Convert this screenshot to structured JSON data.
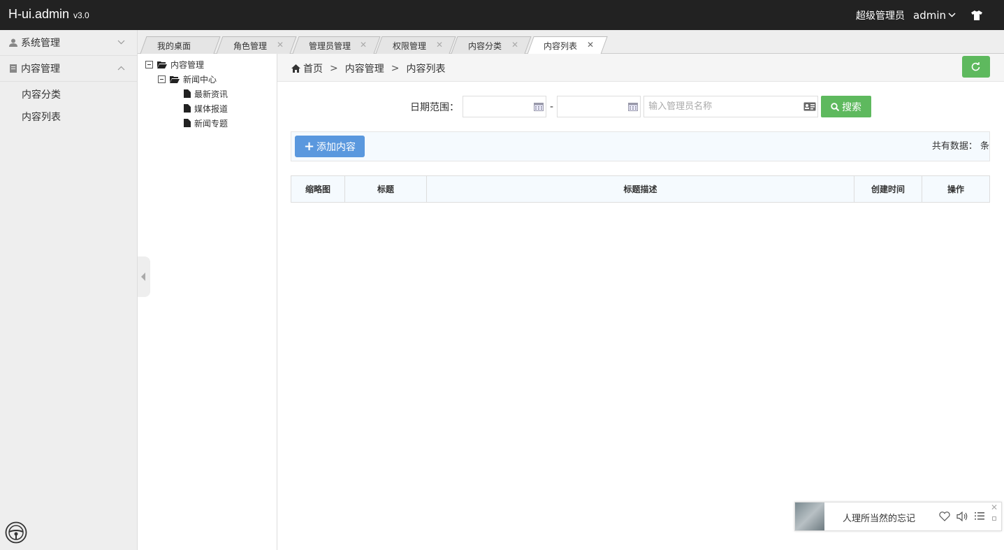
{
  "app": {
    "brand": "H-ui.admin",
    "version": "v3.0",
    "role": "超级管理员",
    "user": "admin"
  },
  "sidebar": {
    "menus": [
      {
        "label": "系统管理",
        "expanded": false
      },
      {
        "label": "内容管理",
        "expanded": true
      }
    ],
    "subitems": [
      "内容分类",
      "内容列表"
    ]
  },
  "tabs": [
    {
      "label": "我的桌面",
      "closable": false
    },
    {
      "label": "角色管理",
      "closable": true
    },
    {
      "label": "管理员管理",
      "closable": true
    },
    {
      "label": "权限管理",
      "closable": true
    },
    {
      "label": "内容分类",
      "closable": true
    },
    {
      "label": "内容列表",
      "closable": true,
      "active": true
    }
  ],
  "tree": {
    "root": "内容管理",
    "child": "新闻中心",
    "leaves": [
      "最新资讯",
      "媒体报道",
      "新闻专题"
    ]
  },
  "breadcrumb": {
    "home": "首页",
    "level1": "内容管理",
    "level2": "内容列表",
    "sep": ">"
  },
  "search": {
    "date_label": "日期范围：",
    "dash": "-",
    "name_placeholder": "输入管理员名称",
    "button": "搜索"
  },
  "toolbar": {
    "add_button": "添加内容",
    "total_text": "共有数据： 条"
  },
  "table": {
    "headers": [
      "缩略图",
      "标题",
      "标题描述",
      "创建时间",
      "操作"
    ]
  },
  "player": {
    "song": "人理所当然的忘记",
    "close": "✕"
  },
  "colors": {
    "topbar": "#222222",
    "green": "#5eb95e",
    "blue": "#5a98de"
  }
}
